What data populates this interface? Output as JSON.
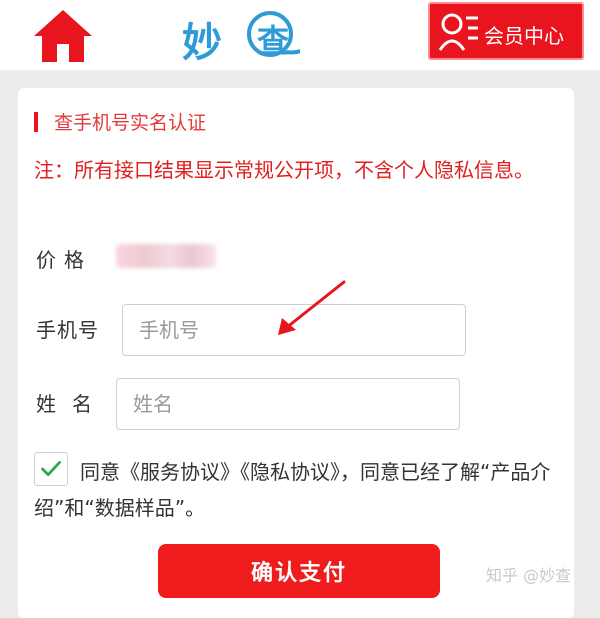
{
  "header": {
    "logo_text": "妙",
    "logo_circle_char": "查",
    "member_label": "会员中心"
  },
  "form": {
    "title": "查手机号实名认证",
    "notice": "注：所有接口结果显示常规公开项，不含个人隐私信息。",
    "price_label": "价格",
    "phone_label": "手机号",
    "phone_placeholder": "手机号",
    "name_label": "姓名",
    "name_placeholder": "姓名",
    "agree_prefix": "同意",
    "service_agreement": "《服务协议》",
    "privacy_agreement": "《隐私协议》",
    "agree_middle": "，同意已经了解",
    "product_intro": "“产品介绍”",
    "agree_and": "和",
    "data_sample": "“数据样品”",
    "agree_end": "。",
    "agree_checked": true,
    "pay_button": "确认支付"
  },
  "watermark": "知乎 @妙查",
  "colors": {
    "brand_red": "#e8141e",
    "logo_blue": "#2e9bd6",
    "check_green": "#2fa84f"
  }
}
